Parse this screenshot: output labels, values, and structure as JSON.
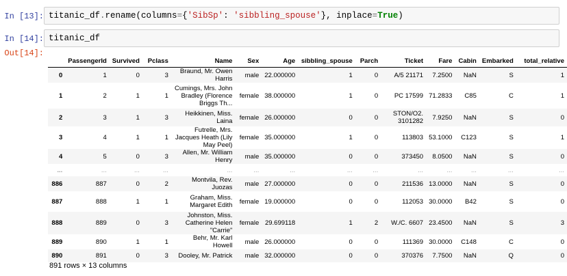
{
  "cells": [
    {
      "prompt": "In [13]:",
      "code_parts": [
        {
          "t": "titanic_df",
          "c": ""
        },
        {
          "t": ".",
          "c": "op"
        },
        {
          "t": "rename(columns",
          "c": ""
        },
        {
          "t": "=",
          "c": "op"
        },
        {
          "t": "{",
          "c": ""
        },
        {
          "t": "'SibSp'",
          "c": "str"
        },
        {
          "t": ": ",
          "c": ""
        },
        {
          "t": "'sibbling_spouse'",
          "c": "str"
        },
        {
          "t": "}, inplace",
          "c": ""
        },
        {
          "t": "=",
          "c": "op"
        },
        {
          "t": "True",
          "c": "kw"
        },
        {
          "t": ")",
          "c": ""
        }
      ]
    },
    {
      "prompt": "In [14]:",
      "code_parts": [
        {
          "t": "titanic_df",
          "c": ""
        }
      ]
    }
  ],
  "output_prompt": "Out[14]:",
  "table": {
    "columns": [
      "",
      "PassengerId",
      "Survived",
      "Pclass",
      "Name",
      "Sex",
      "Age",
      "sibbling_spouse",
      "Parch",
      "Ticket",
      "Fare",
      "Cabin",
      "Embarked",
      "total_relative"
    ],
    "rows": [
      [
        "0",
        "1",
        "0",
        "3",
        "Braund, Mr. Owen Harris",
        "male",
        "22.000000",
        "1",
        "0",
        "A/5 21171",
        "7.2500",
        "NaN",
        "S",
        "1"
      ],
      [
        "1",
        "2",
        "1",
        "1",
        "Cumings, Mrs. John Bradley (Florence Briggs Th...",
        "female",
        "38.000000",
        "1",
        "0",
        "PC 17599",
        "71.2833",
        "C85",
        "C",
        "1"
      ],
      [
        "2",
        "3",
        "1",
        "3",
        "Heikkinen, Miss. Laina",
        "female",
        "26.000000",
        "0",
        "0",
        "STON/O2. 3101282",
        "7.9250",
        "NaN",
        "S",
        "0"
      ],
      [
        "3",
        "4",
        "1",
        "1",
        "Futrelle, Mrs. Jacques Heath (Lily May Peel)",
        "female",
        "35.000000",
        "1",
        "0",
        "113803",
        "53.1000",
        "C123",
        "S",
        "1"
      ],
      [
        "4",
        "5",
        "0",
        "3",
        "Allen, Mr. William Henry",
        "male",
        "35.000000",
        "0",
        "0",
        "373450",
        "8.0500",
        "NaN",
        "S",
        "0"
      ],
      [
        "...",
        "...",
        "...",
        "...",
        "...",
        "...",
        "...",
        "...",
        "...",
        "...",
        "...",
        "...",
        "...",
        "..."
      ],
      [
        "886",
        "887",
        "0",
        "2",
        "Montvila, Rev. Juozas",
        "male",
        "27.000000",
        "0",
        "0",
        "211536",
        "13.0000",
        "NaN",
        "S",
        "0"
      ],
      [
        "887",
        "888",
        "1",
        "1",
        "Graham, Miss. Margaret Edith",
        "female",
        "19.000000",
        "0",
        "0",
        "112053",
        "30.0000",
        "B42",
        "S",
        "0"
      ],
      [
        "888",
        "889",
        "0",
        "3",
        "Johnston, Miss. Catherine Helen \"Carrie\"",
        "female",
        "29.699118",
        "1",
        "2",
        "W./C. 6607",
        "23.4500",
        "NaN",
        "S",
        "3"
      ],
      [
        "889",
        "890",
        "1",
        "1",
        "Behr, Mr. Karl Howell",
        "male",
        "26.000000",
        "0",
        "0",
        "111369",
        "30.0000",
        "C148",
        "C",
        "0"
      ],
      [
        "890",
        "891",
        "0",
        "3",
        "Dooley, Mr. Patrick",
        "male",
        "32.000000",
        "0",
        "0",
        "370376",
        "7.7500",
        "NaN",
        "Q",
        "0"
      ]
    ]
  },
  "footer": "891 rows × 13 columns",
  "colors": {
    "in_prompt": "#303f9f",
    "out_prompt": "#d84315",
    "string": "#ba2121",
    "keyword": "#008000"
  }
}
